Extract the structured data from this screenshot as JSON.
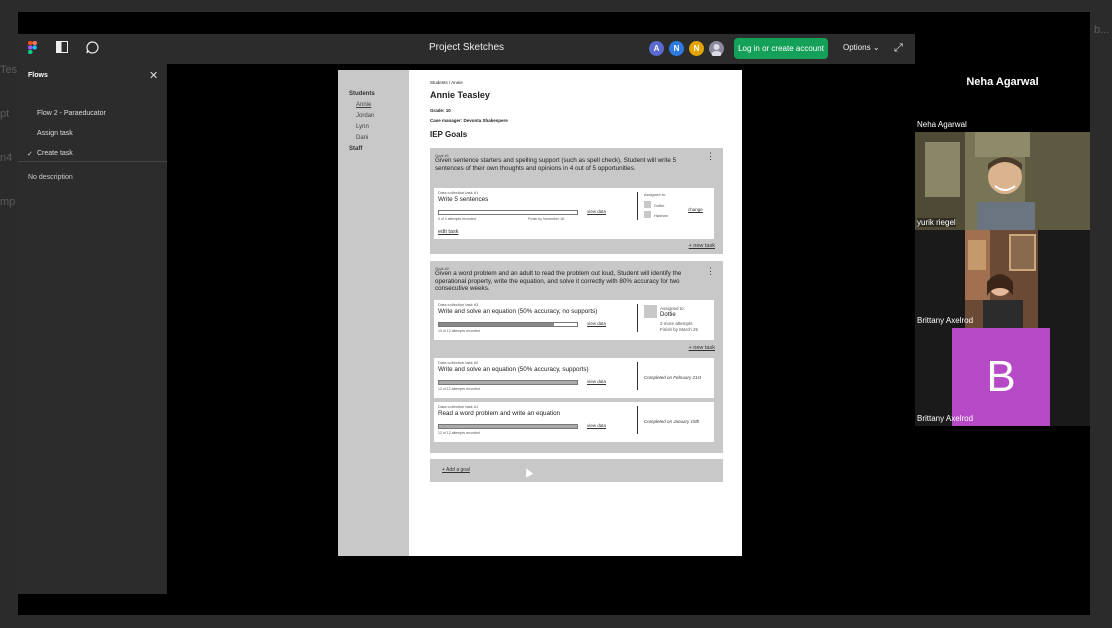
{
  "background_hints": [
    "Tes",
    "pt",
    "n4",
    "mp",
    "b..."
  ],
  "figma": {
    "project_title": "Project Sketches",
    "avatars": [
      {
        "letter": "A",
        "color": "#5a6ad0"
      },
      {
        "letter": "N",
        "color": "#2d7ae0"
      },
      {
        "letter": "N",
        "color": "#e2a500"
      }
    ],
    "login_label": "Log in or create account",
    "options_label": "Options"
  },
  "flows_panel": {
    "title": "Flows",
    "items": [
      "Flow 2 - Paraeducator",
      "Assign task",
      "Create task"
    ],
    "selected_index": 2,
    "check_mark": "✓",
    "no_description": "No description"
  },
  "frame": {
    "sidebar": {
      "students_heading": "Students",
      "students": [
        "Annie",
        "Jordan",
        "Lynn",
        "Dani"
      ],
      "staff_heading": "Staff"
    },
    "breadcrumb": "Students / Annie",
    "student_name": "Annie Teasley",
    "grade": "Grade: 10",
    "case_manager": "Case manager: Devonta Shakespere",
    "iep_heading": "IEP Goals",
    "goals": [
      {
        "label": "Goal #1",
        "text": "Given sentence starters and spelling support (such as spell check), Student will write 5 sentences of their own thoughts and opinions in 4 out of 5 opportunities.",
        "tasks": [
          {
            "label": "Data collection task #1",
            "name": "Write 5 sentences",
            "attempts": "0 of 4 attempts recorded",
            "progress": 0,
            "view_data": "view data",
            "finish": "Finish by November 18",
            "assigned_to_label": "Assigned to:",
            "assignees": [
              "Dottie",
              "Hadrian"
            ],
            "change": "change",
            "edit": "edit task"
          }
        ],
        "new_task": "+ new task"
      },
      {
        "label": "Goal #2",
        "text": "Given a word problem and an adult to read the problem out loud, Student will identify the operational property, write the equation, and solve it correctly with 80% accuracy for two consecutive weeks.",
        "tasks": [
          {
            "label": "Data collection task #3",
            "name": "Write and solve an equation (50% accuracy, no supports)",
            "attempts": "10 of 12 attempts recorded",
            "progress": 0.83,
            "view_data": "view data",
            "assigned_to_label": "Assigned to:",
            "assignee": "Dottie",
            "more_attempts": "2 more attempts",
            "finish": "Finish by March 25"
          },
          {
            "label": "Data collection task #2",
            "name": "Write and solve an equation (50% accuracy, supports)",
            "attempts": "12 of 12 attempts recorded",
            "progress": 1,
            "view_data": "view data",
            "completed": "Completed on February 21st"
          },
          {
            "label": "Data collection task #1",
            "name": "Read a word problem and write an equation",
            "attempts": "12 of 12 attempts recorded",
            "progress": 1,
            "view_data": "view data",
            "completed": "Completed on January 15th"
          }
        ],
        "new_task": "+ new task"
      }
    ],
    "add_goal": "+ Add a goal"
  },
  "video_call": {
    "active_speaker": "Neha Agarwal",
    "participants": [
      "Neha Agarwal",
      "yurik riegel",
      "Brittany Axelrod",
      "Brittany Axelrod"
    ],
    "avatar_letter": "B",
    "avatar_color": "#b549c6"
  }
}
